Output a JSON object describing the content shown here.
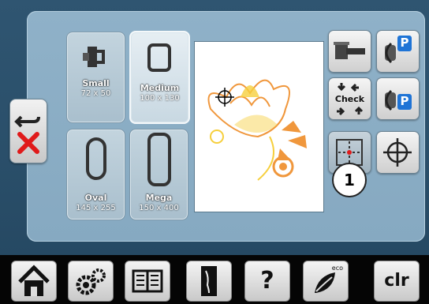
{
  "hoops": [
    {
      "name": "Small",
      "dimensions": "72 x 50",
      "selected": false
    },
    {
      "name": "Medium",
      "dimensions": "100 x 130",
      "selected": true
    },
    {
      "name": "Oval",
      "dimensions": "145 x 255",
      "selected": false
    },
    {
      "name": "Mega",
      "dimensions": "150 x 400",
      "selected": false
    }
  ],
  "tools": {
    "check_label": "Check",
    "park_label": "P",
    "callout": "1"
  },
  "bottom_bar": {
    "clr_label": "clr",
    "eco_label": "eco",
    "help_label": "?"
  },
  "colors": {
    "accent_blue": "#1f74d6",
    "close_red": "#e01a1a",
    "motif_orange": "#f0973c",
    "motif_yellow": "#f6cf3d"
  }
}
